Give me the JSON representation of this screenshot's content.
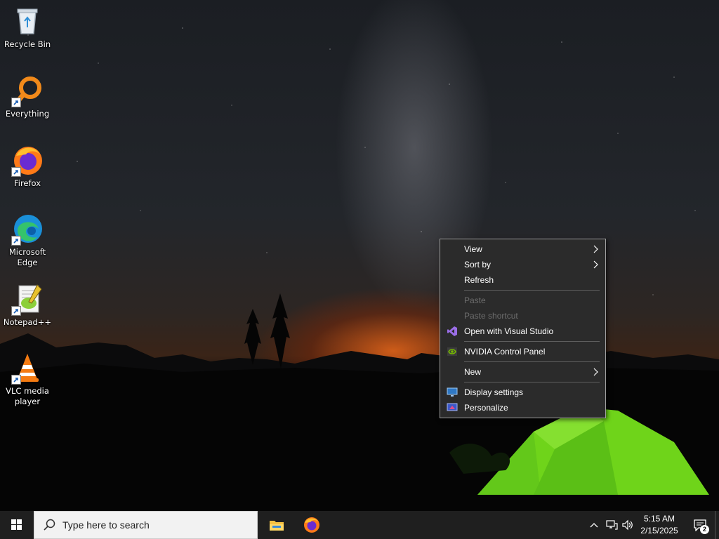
{
  "desktop": {
    "icons": [
      {
        "label": "Recycle Bin",
        "icon": "recycle-bin-icon"
      },
      {
        "label": "Everything",
        "icon": "everything-search-icon"
      },
      {
        "label": "Firefox",
        "icon": "firefox-icon"
      },
      {
        "label": "Microsoft Edge",
        "icon": "edge-icon"
      },
      {
        "label": "Notepad++",
        "icon": "notepadpp-icon"
      },
      {
        "label": "VLC media player",
        "icon": "vlc-icon"
      }
    ]
  },
  "context_menu": {
    "items": [
      {
        "label": "View",
        "submenu": true
      },
      {
        "label": "Sort by",
        "submenu": true
      },
      {
        "label": "Refresh"
      },
      {
        "label": "Paste",
        "disabled": true
      },
      {
        "label": "Paste shortcut",
        "disabled": true
      },
      {
        "label": "Open with Visual Studio",
        "icon": "visual-studio-icon"
      },
      {
        "label": "NVIDIA Control Panel",
        "icon": "nvidia-icon"
      },
      {
        "label": "New",
        "submenu": true
      },
      {
        "label": "Display settings",
        "icon": "display-icon"
      },
      {
        "label": "Personalize",
        "icon": "personalize-icon"
      }
    ]
  },
  "taskbar": {
    "search_placeholder": "Type here to search",
    "pinned_apps": [
      "file-explorer-icon",
      "firefox-icon"
    ],
    "clock": {
      "time": "5:15 AM",
      "date": "2/15/2025"
    },
    "notification_count": "2"
  },
  "colors": {
    "menu_bg": "#2b2b2b",
    "taskbar_bg": "#1f1f1f",
    "tent_green": "#6fd41a",
    "horizon_orange": "#d65f19"
  }
}
